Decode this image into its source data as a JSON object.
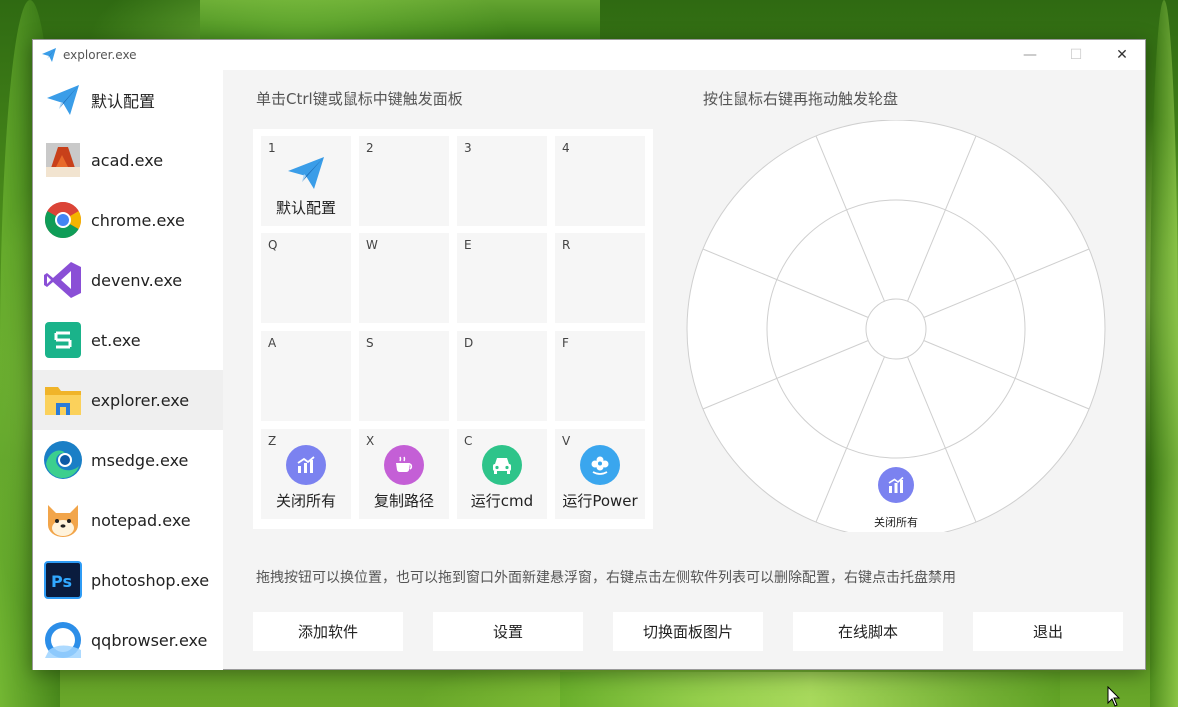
{
  "window": {
    "title": "explorer.exe",
    "minimize_glyph": "—",
    "maximize_glyph": "☐",
    "close_glyph": "✕"
  },
  "sidebar": {
    "items": [
      {
        "label": "默认配置",
        "icon": "paper-plane-icon"
      },
      {
        "label": "acad.exe",
        "icon": "autocad-icon"
      },
      {
        "label": "chrome.exe",
        "icon": "chrome-icon"
      },
      {
        "label": "devenv.exe",
        "icon": "visual-studio-icon"
      },
      {
        "label": "et.exe",
        "icon": "wps-spreadsheet-icon"
      },
      {
        "label": "explorer.exe",
        "icon": "folder-icon",
        "active": true
      },
      {
        "label": "msedge.exe",
        "icon": "edge-icon"
      },
      {
        "label": "notepad.exe",
        "icon": "shiba-dog-icon"
      },
      {
        "label": "photoshop.exe",
        "icon": "photoshop-icon"
      },
      {
        "label": "qqbrowser.exe",
        "icon": "qqbrowser-icon"
      }
    ]
  },
  "panel": {
    "title": "单击Ctrl键或鼠标中键触发面板",
    "cells": [
      {
        "key": "1",
        "label": "默认配置",
        "icon": "paper-plane-icon"
      },
      {
        "key": "2",
        "label": ""
      },
      {
        "key": "3",
        "label": ""
      },
      {
        "key": "4",
        "label": ""
      },
      {
        "key": "Q",
        "label": ""
      },
      {
        "key": "W",
        "label": ""
      },
      {
        "key": "E",
        "label": ""
      },
      {
        "key": "R",
        "label": ""
      },
      {
        "key": "A",
        "label": ""
      },
      {
        "key": "S",
        "label": ""
      },
      {
        "key": "D",
        "label": ""
      },
      {
        "key": "F",
        "label": ""
      },
      {
        "key": "Z",
        "label": "关闭所有",
        "icon": "chart-icon"
      },
      {
        "key": "X",
        "label": "复制路径",
        "icon": "coffee-icon"
      },
      {
        "key": "C",
        "label": "运行cmd",
        "icon": "car-icon"
      },
      {
        "key": "V",
        "label": "运行Power",
        "icon": "flower-icon"
      }
    ]
  },
  "wheel": {
    "title": "按住鼠标右键再拖动触发轮盘",
    "item_label": "关闭所有",
    "item_icon": "chart-icon"
  },
  "hint": "拖拽按钮可以换位置，也可以拖到窗口外面新建悬浮窗，右键点击左侧软件列表可以删除配置，右键点击托盘禁用",
  "buttons": {
    "add": "添加软件",
    "settings": "设置",
    "switch_image": "切换面板图片",
    "online_script": "在线脚本",
    "exit": "退出"
  },
  "colors": {
    "chart_icon": "#7b82f0",
    "coffee_icon": "#c45fd6",
    "car_icon": "#2ec48a",
    "flower_icon": "#3aa6ee",
    "plane": "#3a9de8"
  }
}
